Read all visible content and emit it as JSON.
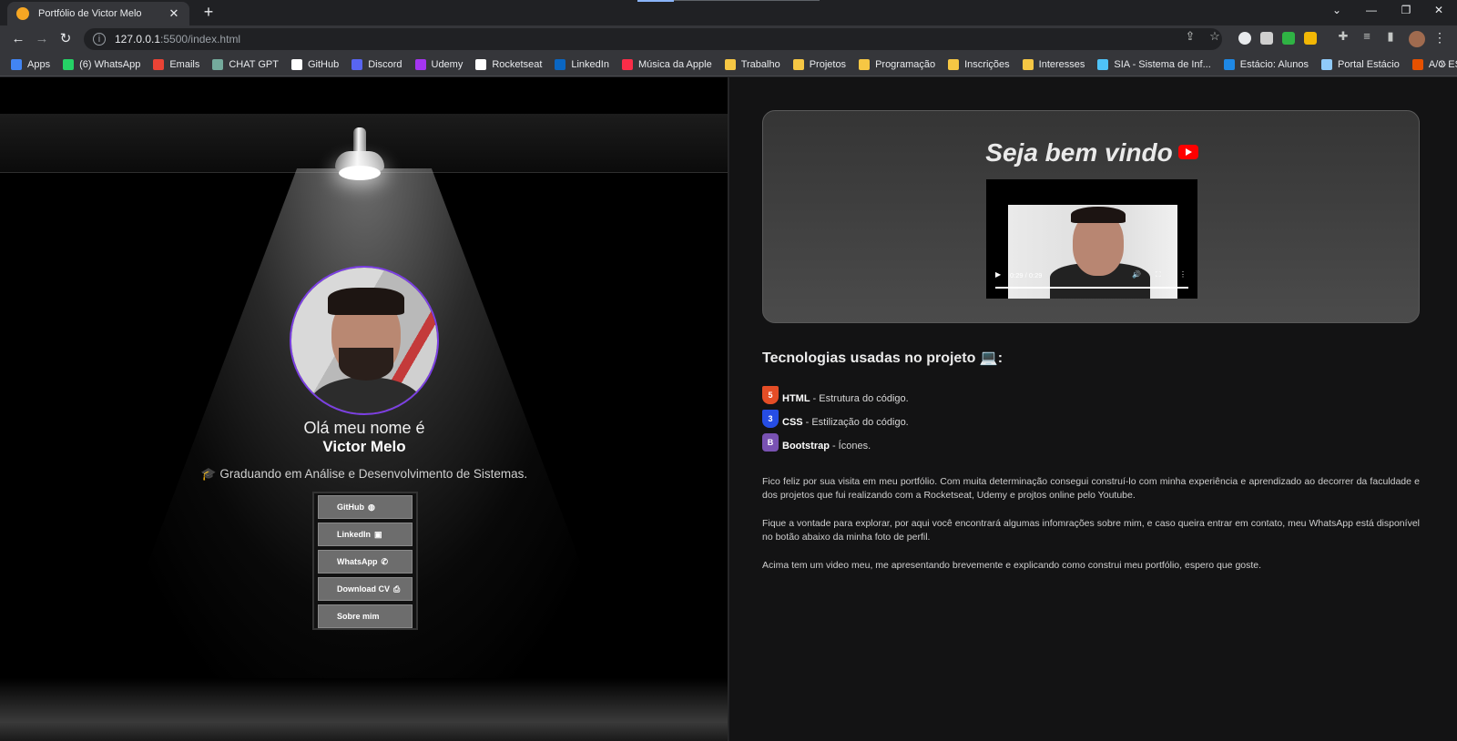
{
  "browser": {
    "tab_title": "Portfólio de Victor Melo",
    "tab_close": "✕",
    "new_tab": "+",
    "url_host": "127.0.0.1",
    "url_path": ":5500/index.html",
    "bookmarks": [
      {
        "label": "Apps",
        "color": "#4285f4"
      },
      {
        "label": "(6) WhatsApp",
        "color": "#25d366"
      },
      {
        "label": "Emails",
        "color": "#ea4335"
      },
      {
        "label": "CHAT GPT",
        "color": "#74aa9c"
      },
      {
        "label": "GitHub",
        "color": "#ffffff"
      },
      {
        "label": "Discord",
        "color": "#5865f2"
      },
      {
        "label": "Udemy",
        "color": "#a435f0"
      },
      {
        "label": "Rocketseat",
        "color": "#ffffff"
      },
      {
        "label": "LinkedIn",
        "color": "#0a66c2"
      },
      {
        "label": "Música da Apple",
        "color": "#fa2d48"
      },
      {
        "label": "Trabalho",
        "color": "#f6c744"
      },
      {
        "label": "Projetos",
        "color": "#f6c744"
      },
      {
        "label": "Programação",
        "color": "#f6c744"
      },
      {
        "label": "Inscrições",
        "color": "#f6c744"
      },
      {
        "label": "Interesses",
        "color": "#f6c744"
      },
      {
        "label": "SIA - Sistema de Inf...",
        "color": "#4fc3f7"
      },
      {
        "label": "Estácio: Alunos",
        "color": "#1e88e5"
      },
      {
        "label": "Portal Estácio",
        "color": "#90caf9"
      },
      {
        "label": "A/C ESTÁCIO",
        "color": "#e65100"
      }
    ],
    "bookmarks_more": "»"
  },
  "left": {
    "greeting": "Olá meu nome é",
    "name": "Victor Melo",
    "subtitle": "🎓 Graduando em Análise e Desenvolvimento de Sistemas.",
    "buttons": [
      {
        "label": "GitHub",
        "icon": "◍"
      },
      {
        "label": "LinkedIn",
        "icon": "▣"
      },
      {
        "label": "WhatsApp",
        "icon": "✆"
      },
      {
        "label": "Download CV",
        "icon": "⎙"
      },
      {
        "label": "Sobre mim",
        "icon": ""
      }
    ]
  },
  "right": {
    "welcome": "Seja bem vindo",
    "video_time": "0:29 / 0:29",
    "tech_title": "Tecnologias usadas no projeto 💻:",
    "techs": [
      {
        "name": "HTML",
        "desc": "- Estrutura do código.",
        "color": "#e44d26",
        "glyph": "5"
      },
      {
        "name": "CSS",
        "desc": "- Estilização do código.",
        "color": "#264de4",
        "glyph": "3"
      },
      {
        "name": "Bootstrap",
        "desc": "- Ícones.",
        "color": "#7952b3",
        "glyph": "B"
      }
    ],
    "paragraphs": [
      "Fico feliz por sua visita em meu portfólio. Com muita determinação consegui construí-lo com minha experiência e aprendizado ao decorrer da faculdade e dos projetos que fui realizando com a Rocketseat, Udemy e projtos online pelo Youtube.",
      "Fique a vontade para explorar, por aqui você encontrará algumas infomrações sobre mim, e caso queira entrar em contato, meu WhatsApp está disponível no botão abaixo da minha foto de perfil.",
      "Acima tem um video meu, me apresentando brevemente e explicando como construi meu portfólio, espero que goste."
    ]
  }
}
